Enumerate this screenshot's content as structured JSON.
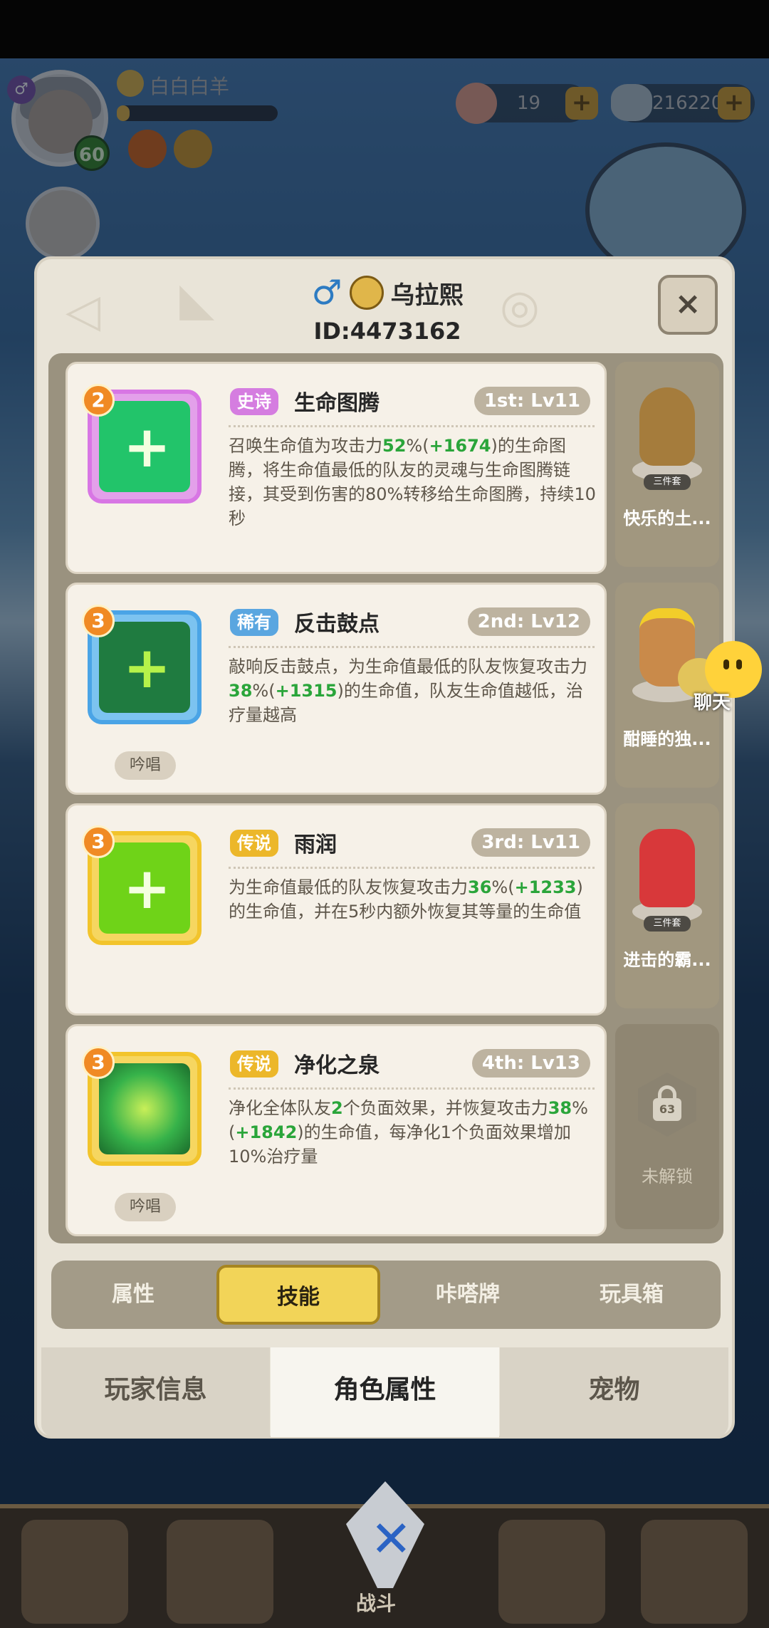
{
  "hud": {
    "player_name": "白白白羊",
    "level": "60",
    "shells": "19",
    "gems": "216220",
    "plus": "+"
  },
  "dialog": {
    "name": "乌拉熙",
    "id": "ID:4473162",
    "close": "×"
  },
  "skills": [
    {
      "level_badge": "2",
      "rarity": "史诗",
      "name": "生命图腾",
      "slot": "1st: Lv11",
      "desc_parts": [
        "召唤生命值为攻击力",
        "52",
        "%(",
        "+1674",
        ")的生命图腾，将生命值最低的队友的灵魂与生命图腾链接，其受到伤害的80%转移给生命图腾，持续10秒"
      ],
      "chant": "",
      "toy_label": "快乐的土...",
      "toy_tag": "三件套",
      "icon_color": "#22c46a",
      "frame_color": "#d876e4"
    },
    {
      "level_badge": "3",
      "rarity": "稀有",
      "name": "反击鼓点",
      "slot": "2nd: Lv12",
      "desc_parts": [
        "敲响反击鼓点，为生命值最低的队友恢复攻击力",
        "38",
        "%(",
        "+1315",
        ")的生命值，队友生命值越低，治疗量越高"
      ],
      "chant": "吟唱",
      "toy_label": "酣睡的独...",
      "toy_tag": "",
      "icon_color": "#1f7b40",
      "frame_color": "#4aa4e6"
    },
    {
      "level_badge": "3",
      "rarity": "传说",
      "name": "雨润",
      "slot": "3rd: Lv11",
      "desc_parts": [
        "为生命值最低的队友恢复攻击力",
        "36",
        "%(",
        "+1233",
        ")的生命值，并在5秒内额外恢复其等量的生命值"
      ],
      "chant": "",
      "toy_label": "进击的霸...",
      "toy_tag": "三件套",
      "icon_color": "#6fd318",
      "frame_color": "#f2c42c"
    },
    {
      "level_badge": "3",
      "rarity": "传说",
      "name": "净化之泉",
      "slot": "4th: Lv13",
      "desc_parts_a": [
        "净化全体队友",
        "2",
        "个负面效果，并恢复攻击力",
        "38",
        "%(",
        "+1842",
        ")的生命值，每净化1个负面效果增加10%治疗量"
      ],
      "chant": "吟唱",
      "lock_level": "63",
      "lock_label": "未解锁",
      "icon_color": "#36b24a",
      "frame_color": "#f2c42c"
    }
  ],
  "chat": {
    "label": "聊天"
  },
  "subtabs": [
    "属性",
    "技能",
    "咔嗒牌",
    "玩具箱"
  ],
  "subtab_active": "技能",
  "maintabs": [
    "玩家信息",
    "角色属性",
    "宠物"
  ],
  "maintab_active": "角色属性",
  "bottom_nav": {
    "center_label": "战斗"
  }
}
